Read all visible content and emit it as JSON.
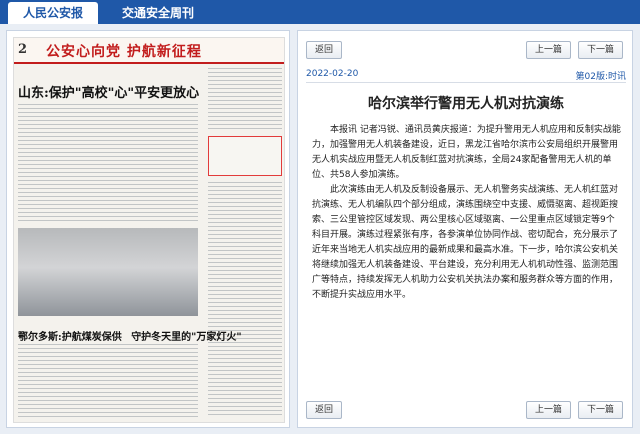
{
  "tabs": [
    {
      "label": "人民公安报",
      "active": true
    },
    {
      "label": "交通安全周刊",
      "active": false
    }
  ],
  "newspaper": {
    "page_number": "2",
    "masthead_title": "公安心向党 护航新征程",
    "headline": "山东:保护\"高校\"心\"平安更放心",
    "bottom_headlines": [
      "鄂尔多斯:护航煤炭保供",
      "守护冬天里的\"万家灯火\""
    ]
  },
  "article": {
    "back_label": "返回",
    "prev_label": "上一篇",
    "next_label": "下一篇",
    "date": "2022-02-20",
    "edition": "第02版:时讯",
    "title": "哈尔滨举行警用无人机对抗演练",
    "paragraphs": [
      "本报讯 记者冯锐、通讯员黄庆报道：为提升警用无人机应用和反制实战能力，加强警用无人机装备建设，近日，黑龙江省哈尔滨市公安局组织开展警用无人机实战应用暨无人机反制红蓝对抗演练，全局24家配备警用无人机的单位、共58人参加演练。",
      "此次演练由无人机及反制设备展示、无人机警务实战演练、无人机红蓝对抗演练、无人机编队四个部分组成，演练围绕空中支援、威慑驱离、超视距搜索、三公里管控区域发现、两公里核心区域驱离、一公里重点区域锁定等9个科目开展。演练过程紧张有序，各参演单位协同作战、密切配合，充分展示了近年来当地无人机实战应用的最新成果和最高水准。下一步，哈尔滨公安机关将继续加强无人机装备建设、平台建设，充分利用无人机机动性强、监测范围广等特点，持续发挥无人机助力公安机关执法办案和服务群众等方面的作用，不断提升实战应用水平。"
    ]
  }
}
